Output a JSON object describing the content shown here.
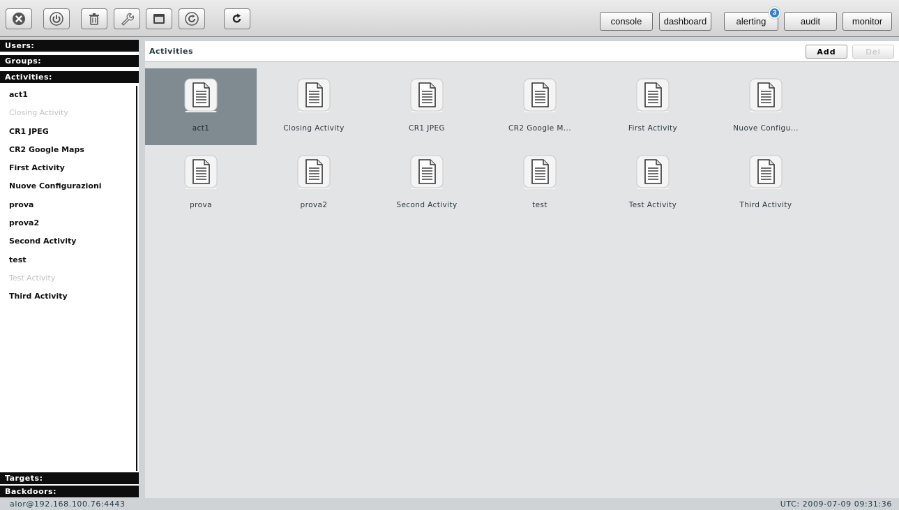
{
  "toolbar": {
    "buttons": [
      {
        "icon": "close-circle-icon"
      },
      {
        "icon": "power-icon"
      },
      {
        "icon": "trash-icon"
      },
      {
        "icon": "wrench-icon"
      },
      {
        "icon": "window-icon"
      },
      {
        "icon": "refresh-circle-icon"
      },
      {
        "icon": "reload-icon"
      }
    ],
    "nav": {
      "console": "console",
      "dashboard": "dashboard",
      "alerting": "alerting",
      "alerting_badge": "3",
      "audit": "audit",
      "monitor": "monitor"
    }
  },
  "sidebar": {
    "users": "Users:",
    "groups": "Groups:",
    "activities": "Activities:",
    "targets": "Targets:",
    "backdoors": "Backdoors:",
    "items": [
      {
        "label": "act1",
        "dim": false
      },
      {
        "label": "Closing Activity",
        "dim": true
      },
      {
        "label": "CR1 JPEG",
        "dim": false
      },
      {
        "label": "CR2 Google Maps",
        "dim": false
      },
      {
        "label": "First Activity",
        "dim": false
      },
      {
        "label": "Nuove Configurazioni",
        "dim": false
      },
      {
        "label": "prova",
        "dim": false
      },
      {
        "label": "prova2",
        "dim": false
      },
      {
        "label": "Second Activity",
        "dim": false
      },
      {
        "label": "test",
        "dim": false
      },
      {
        "label": "Test Activity",
        "dim": true
      },
      {
        "label": "Third Activity",
        "dim": false
      }
    ]
  },
  "main": {
    "title": "Activities",
    "add_label": "Add",
    "del_label": "Del",
    "tiles": [
      {
        "label": "act1",
        "selected": true
      },
      {
        "label": "Closing Activity",
        "selected": false
      },
      {
        "label": "CR1 JPEG",
        "selected": false
      },
      {
        "label": "CR2 Google M...",
        "selected": false
      },
      {
        "label": "First Activity",
        "selected": false
      },
      {
        "label": "Nuove Configu...",
        "selected": false
      },
      {
        "label": "prova",
        "selected": false
      },
      {
        "label": "prova2",
        "selected": false
      },
      {
        "label": "Second Activity",
        "selected": false
      },
      {
        "label": "test",
        "selected": false
      },
      {
        "label": "Test Activity",
        "selected": false
      },
      {
        "label": "Third Activity",
        "selected": false
      }
    ]
  },
  "status": {
    "user": "alor@192.168.100.76:4443",
    "time": "UTC: 2009-07-09 09:31:36"
  },
  "colors": {
    "accent": "#2f7fd6",
    "selected_tile": "#7f8b91",
    "section_header": "#0d0d0d"
  }
}
